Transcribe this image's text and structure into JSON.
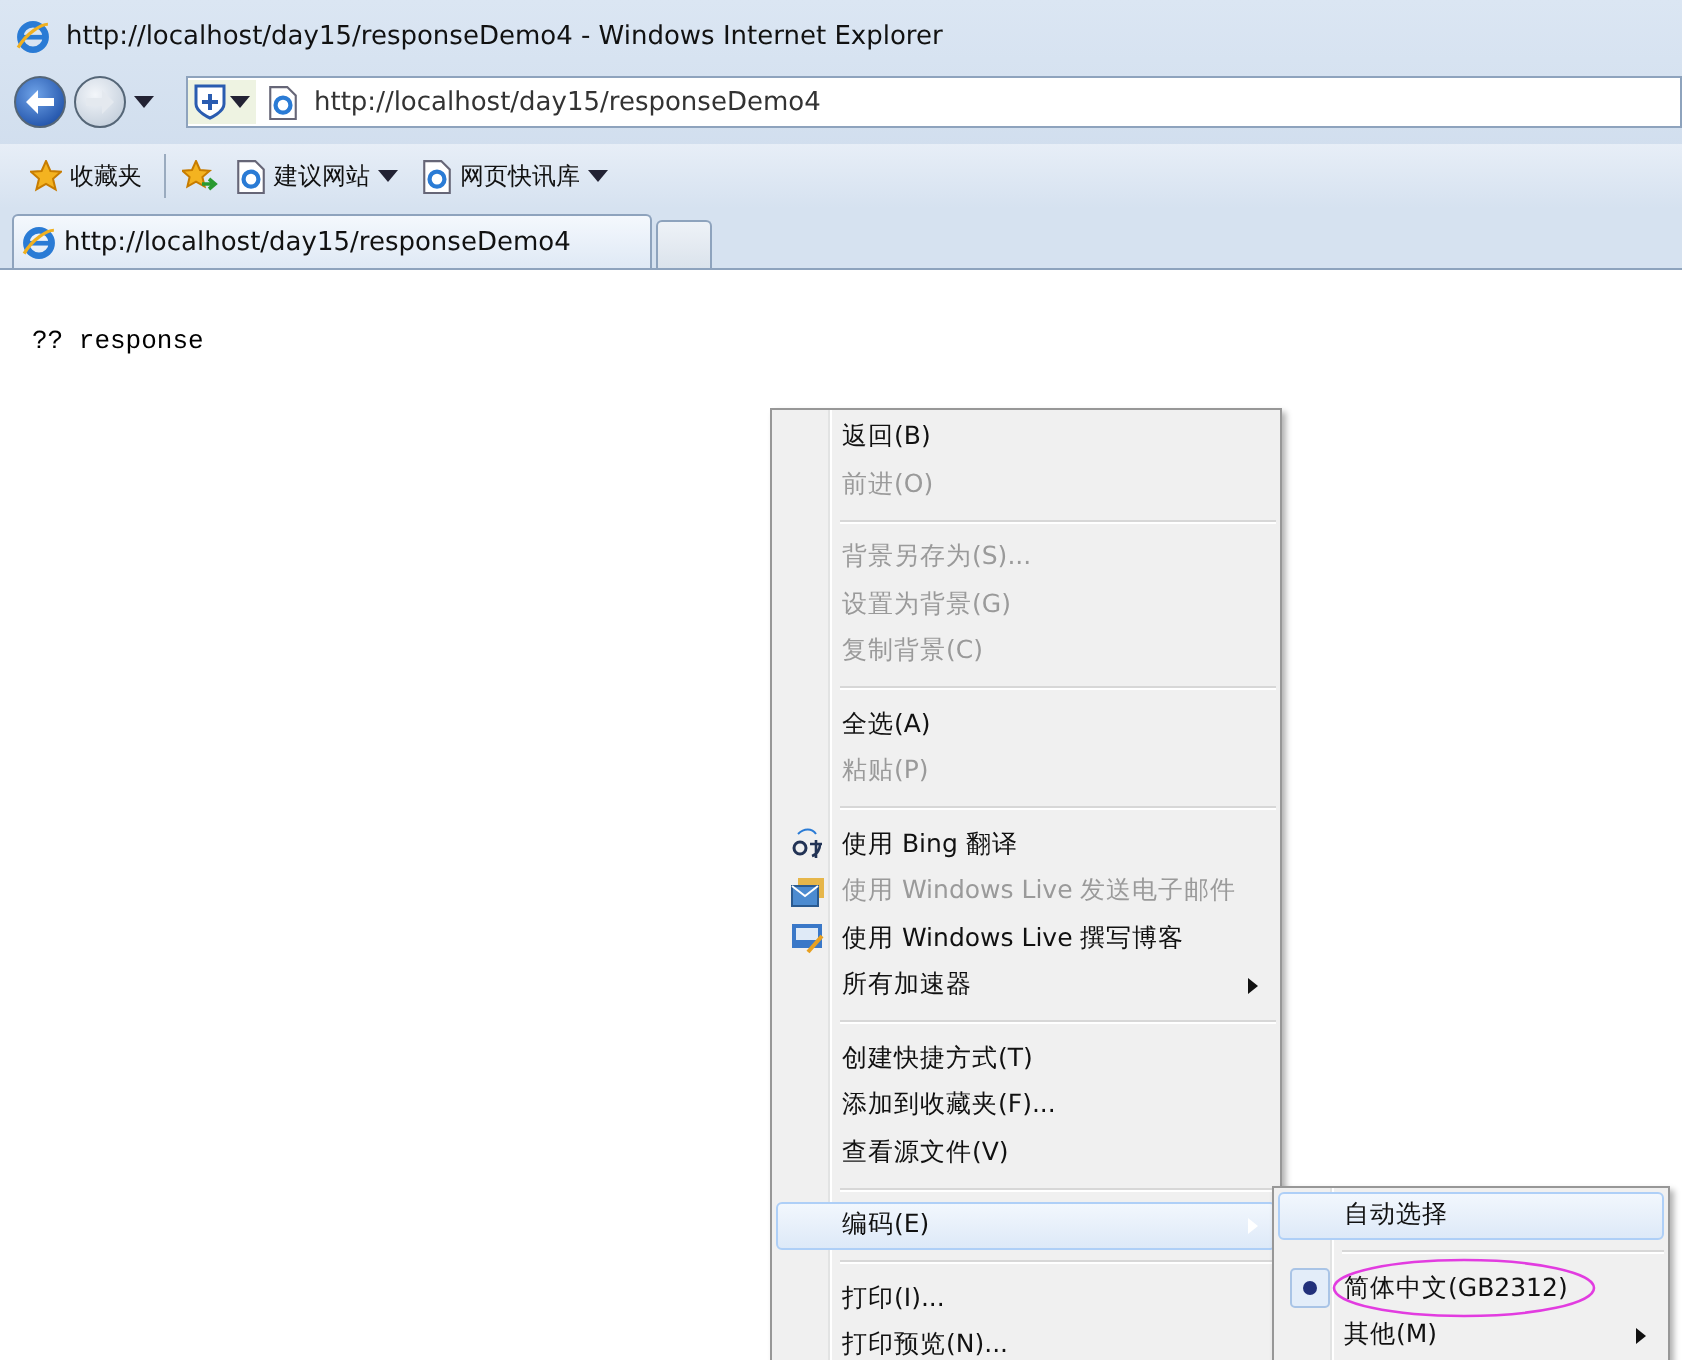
{
  "window": {
    "title": "http://localhost/day15/responseDemo4 - Windows Internet Explorer"
  },
  "address": {
    "value": "http://localhost/day15/responseDemo4"
  },
  "favorites_bar": {
    "favorites": "收藏夹",
    "links": [
      {
        "label": "建议网站"
      },
      {
        "label": "网页快讯库"
      }
    ]
  },
  "tabs": [
    {
      "label": "http://localhost/day15/responseDemo4",
      "selected": true
    },
    {
      "selected": false
    }
  ],
  "page_text": "?? response",
  "context_menu": [
    {
      "kind": "item",
      "label": "返回(B)",
      "disabled": false
    },
    {
      "kind": "item",
      "label": "前进(O)",
      "disabled": true
    },
    {
      "kind": "separator"
    },
    {
      "kind": "item",
      "label": "背景另存为(S)...",
      "disabled": true
    },
    {
      "kind": "item",
      "label": "设置为背景(G)",
      "disabled": true
    },
    {
      "kind": "item",
      "label": "复制背景(C)",
      "disabled": true
    },
    {
      "kind": "separator"
    },
    {
      "kind": "item",
      "label": "全选(A)",
      "disabled": false
    },
    {
      "kind": "item",
      "label": "粘贴(P)",
      "disabled": true
    },
    {
      "kind": "separator"
    },
    {
      "kind": "icon_item",
      "label": "使用 Bing 翻译",
      "disabled": false
    },
    {
      "kind": "icon_item",
      "label": "使用 Windows Live 发送电子邮件",
      "disabled": true
    },
    {
      "kind": "icon_item",
      "label": "使用 Windows Live 撰写博客",
      "disabled": false
    },
    {
      "kind": "item",
      "label": "所有加速器",
      "disabled": false,
      "submenu": true
    },
    {
      "kind": "separator"
    },
    {
      "kind": "item",
      "label": "创建快捷方式(T)",
      "disabled": false
    },
    {
      "kind": "item",
      "label": "添加到收藏夹(F)...",
      "disabled": false
    },
    {
      "kind": "item",
      "label": "查看源文件(V)",
      "disabled": false
    },
    {
      "kind": "separator"
    },
    {
      "kind": "item",
      "label": "编码(E)",
      "disabled": false,
      "submenu": true,
      "highlighted": true
    },
    {
      "kind": "separator"
    },
    {
      "kind": "item",
      "label": "打印(I)...",
      "disabled": false
    },
    {
      "kind": "item",
      "label": "打印预览(N)...",
      "disabled": false
    }
  ],
  "encoding_submenu": [
    {
      "kind": "item",
      "label": "自动选择",
      "highlighted": true,
      "selected": false
    },
    {
      "kind": "separator"
    },
    {
      "kind": "item",
      "label": "简体中文(GB2312)",
      "highlighted": false,
      "selected": true,
      "circled": true
    },
    {
      "kind": "item",
      "label": "其他(M)",
      "highlighted": false,
      "selected": false,
      "submenu": true
    }
  ]
}
